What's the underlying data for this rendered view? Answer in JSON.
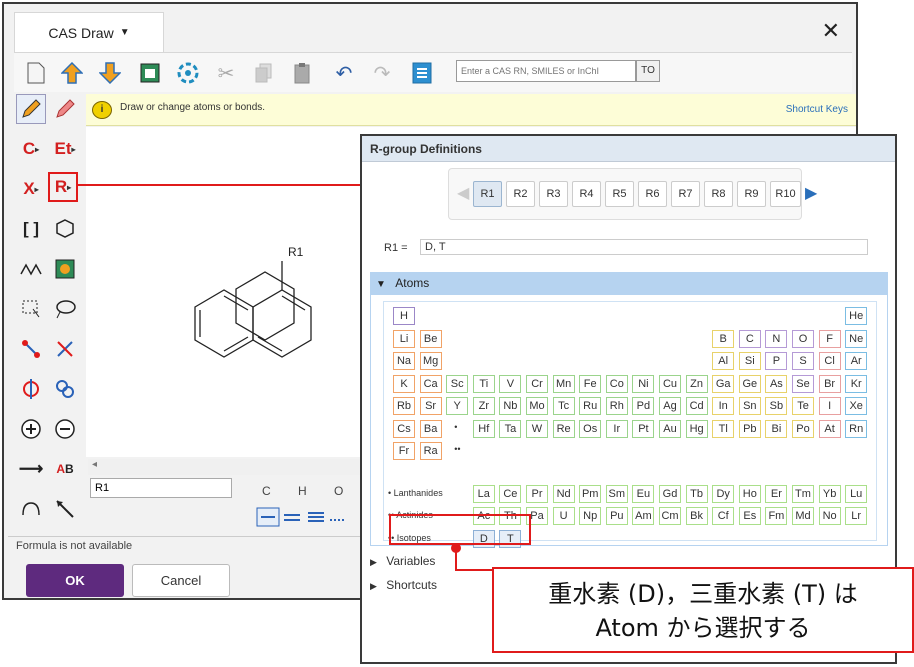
{
  "window": {
    "title": "CAS Draw",
    "close_glyph": "✕",
    "cas_input_placeholder": "Enter a CAS RN, SMILES or InChI",
    "cas_button_label": "TO",
    "hint_text": "Draw or change atoms or bonds.",
    "shortcut_keys_label": "Shortcut Keys",
    "left_tools": {
      "carbon": "C",
      "ethyl": "Et",
      "halogen": "X",
      "rgroup": "R"
    },
    "structure_label": "R1",
    "r1_field_value": "R1",
    "element_strip": "C H O S N",
    "formula_status": "Formula is not available",
    "ok_label": "OK",
    "cancel_label": "Cancel"
  },
  "rgroup": {
    "title": "R-group Definitions",
    "tabs": [
      "R1",
      "R2",
      "R3",
      "R4",
      "R5",
      "R6",
      "R7",
      "R8",
      "R9",
      "R10"
    ],
    "active_tab": "R1",
    "r1_label": "R1 =",
    "r1_value": "D, T",
    "atoms_header": "Atoms",
    "lanthanides_label": "Lanthanides",
    "actinides_label": "Actinides",
    "isotopes_label": "Isotopes",
    "single_dot": "•",
    "double_dot": "••",
    "variables_label": "Variables",
    "shortcuts_label": "Shortcuts",
    "rows": [
      [
        "H"
      ],
      [
        "Li",
        "Be",
        "B",
        "C",
        "N",
        "O",
        "F",
        "Ne"
      ],
      [
        "Na",
        "Mg",
        "Al",
        "Si",
        "P",
        "S",
        "Cl",
        "Ar"
      ],
      [
        "K",
        "Ca",
        "Sc",
        "Ti",
        "V",
        "Cr",
        "Mn",
        "Fe",
        "Co",
        "Ni",
        "Cu",
        "Zn",
        "Ga",
        "Ge",
        "As",
        "Se",
        "Br",
        "Kr"
      ],
      [
        "Rb",
        "Sr",
        "Y",
        "Zr",
        "Nb",
        "Mo",
        "Tc",
        "Ru",
        "Rh",
        "Pd",
        "Ag",
        "Cd",
        "In",
        "Sn",
        "Sb",
        "Te",
        "I",
        "Xe"
      ],
      [
        "Cs",
        "Ba",
        "Hf",
        "Ta",
        "W",
        "Re",
        "Os",
        "Ir",
        "Pt",
        "Au",
        "Hg",
        "Tl",
        "Pb",
        "Bi",
        "Po",
        "At",
        "Rn"
      ],
      [
        "Fr",
        "Ra"
      ]
    ],
    "he": "He",
    "lanthanides": [
      "La",
      "Ce",
      "Pr",
      "Nd",
      "Pm",
      "Sm",
      "Eu",
      "Gd",
      "Tb",
      "Dy",
      "Ho",
      "Er",
      "Tm",
      "Yb",
      "Lu"
    ],
    "actinides": [
      "Ac",
      "Th",
      "Pa",
      "U",
      "Np",
      "Pu",
      "Am",
      "Cm",
      "Bk",
      "Cf",
      "Es",
      "Fm",
      "Md",
      "No",
      "Lr"
    ],
    "isotopes": [
      "D",
      "T"
    ]
  },
  "callout": {
    "line1": "重水素 (D)，三重水素 (T) は",
    "line2": "Atom から選択する"
  },
  "colors": {
    "accent_red": "#e01b1b",
    "ok_purple": "#5e2a7e",
    "atoms_header_blue": "#b6d3f0"
  }
}
